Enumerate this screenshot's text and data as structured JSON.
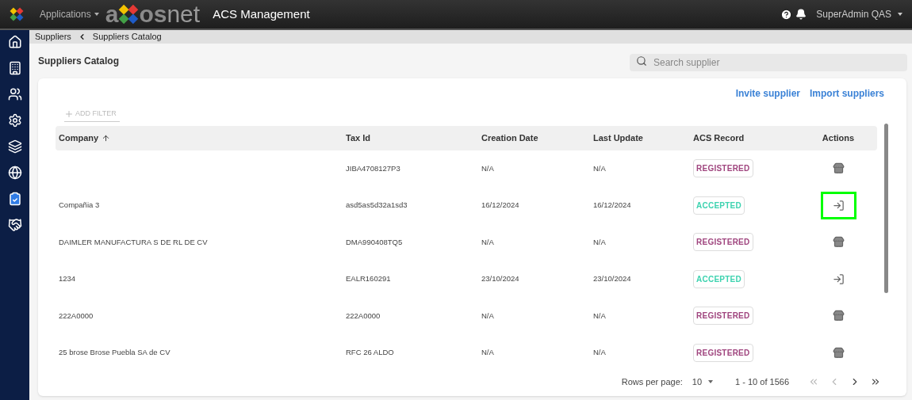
{
  "header": {
    "menu": "Applications",
    "brand": {
      "lead": "a",
      "bold": "os",
      "light": "net"
    },
    "title": "ACS Management",
    "user": "SuperAdmin QAS"
  },
  "sidebar": {
    "items": [
      {
        "kind": "home",
        "selected": false
      },
      {
        "kind": "building",
        "selected": false
      },
      {
        "kind": "users",
        "selected": false
      },
      {
        "kind": "settings",
        "selected": false
      },
      {
        "kind": "layers",
        "selected": false
      },
      {
        "kind": "globe",
        "selected": false
      },
      {
        "kind": "clipboard",
        "selected": true
      },
      {
        "kind": "handshake",
        "selected": false
      }
    ]
  },
  "breadcrumb": [
    "Suppliers",
    "Suppliers Catalog"
  ],
  "page_title": "Suppliers Catalog",
  "search": {
    "placeholder": "Search supplier"
  },
  "links": [
    "Invite supplier",
    "Import suppliers"
  ],
  "add_filter": "ADD FILTER",
  "table": {
    "columns": [
      "Company",
      "Tax Id",
      "Creation Date",
      "Last Update",
      "ACS Record",
      "Actions"
    ],
    "rows": [
      {
        "company": "",
        "tax_id": "JIBA4708127P3",
        "created": "N/A",
        "updated": "N/A",
        "record": "REGISTERED",
        "kind": "registered",
        "highlighted": false
      },
      {
        "company": "Compañia 3",
        "tax_id": "asd5as5d32a1sd3",
        "created": "16/12/2024",
        "updated": "16/12/2024",
        "record": "ACCEPTED",
        "kind": "accepted",
        "highlighted": true
      },
      {
        "company": "DAIMLER MANUFACTURA S DE RL DE CV",
        "tax_id": "DMA990408TQ5",
        "created": "N/A",
        "updated": "N/A",
        "record": "REGISTERED",
        "kind": "registered",
        "highlighted": false
      },
      {
        "company": "1234",
        "tax_id": "EALR160291",
        "created": "23/10/2024",
        "updated": "23/10/2024",
        "record": "ACCEPTED",
        "kind": "accepted",
        "highlighted": false
      },
      {
        "company": "222A0000",
        "tax_id": "222A0000",
        "created": "N/A",
        "updated": "N/A",
        "record": "REGISTERED",
        "kind": "registered",
        "highlighted": false
      },
      {
        "company": "25 brose Brose Puebla SA de CV",
        "tax_id": "RFC 26 ALDO",
        "created": "N/A",
        "updated": "N/A",
        "record": "REGISTERED",
        "kind": "registered",
        "highlighted": false
      }
    ]
  },
  "pagination": {
    "label": "Rows per page:",
    "per_page": "10",
    "range": "1 - 10 of 1566"
  }
}
